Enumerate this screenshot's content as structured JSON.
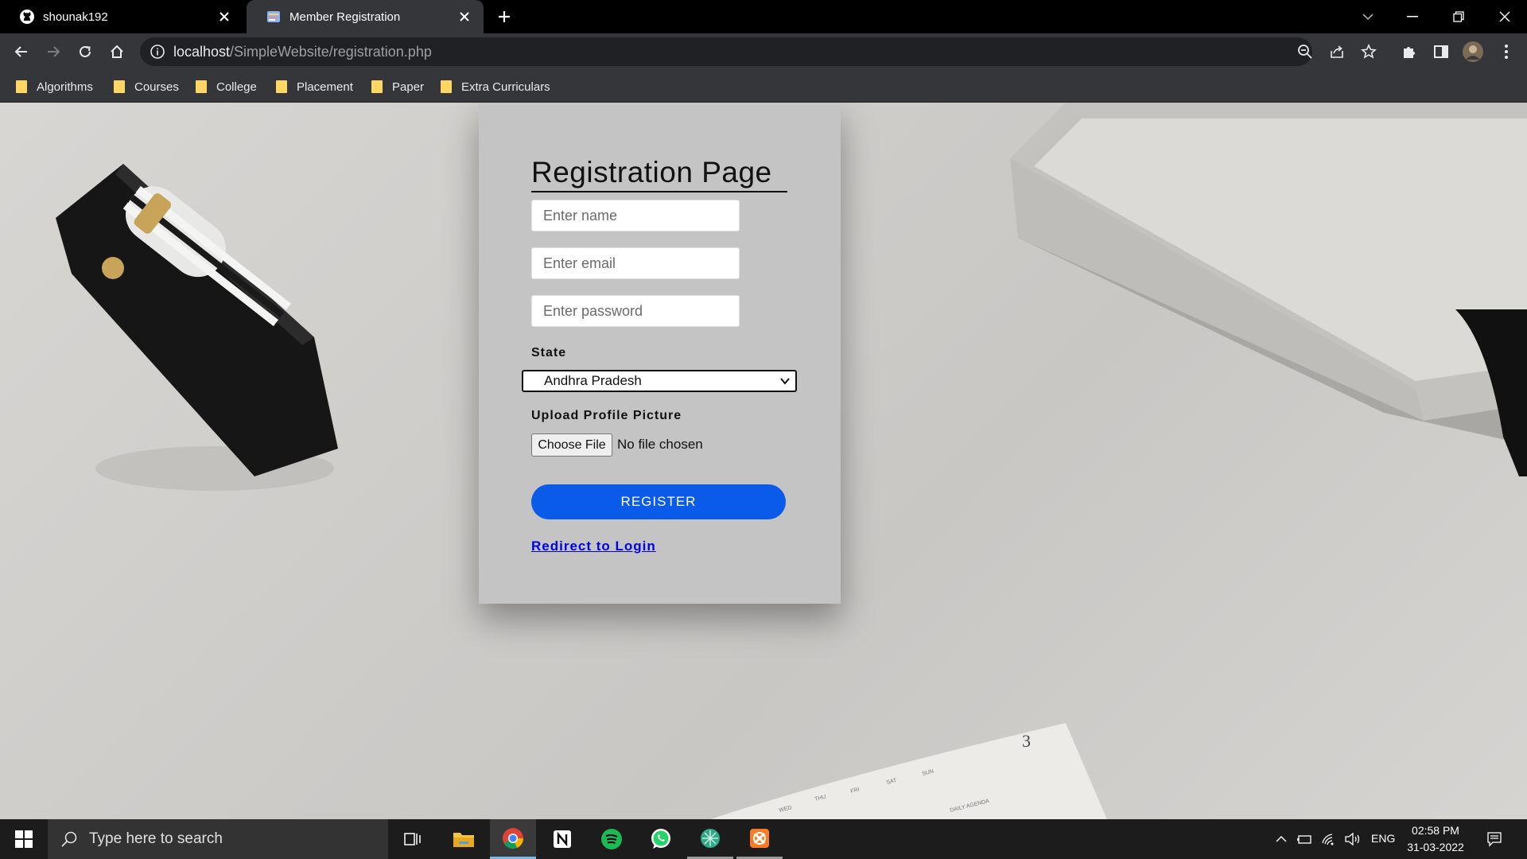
{
  "browser": {
    "tabs": [
      {
        "title": "shounak192",
        "favicon": "github-icon",
        "active": false
      },
      {
        "title": "Member Registration",
        "favicon": "page-icon",
        "active": true
      }
    ],
    "url": {
      "host": "localhost",
      "path": "/SimpleWebsite/registration.php"
    },
    "bookmarks": [
      "Algorithms",
      "Courses",
      "College",
      "Placement",
      "Paper",
      "Extra Curriculars"
    ]
  },
  "form": {
    "title": "Registration Page",
    "name_placeholder": "Enter name",
    "email_placeholder": "Enter email",
    "password_placeholder": "Enter password",
    "state_label": "State",
    "state_value": "Andhra Pradesh",
    "upload_label": "Upload Profile Picture",
    "choose_file_label": "Choose File",
    "file_status": "No file chosen",
    "register_label": "REGISTER",
    "login_link": "Redirect to Login",
    "accent_color": "#0a5bea"
  },
  "background": {
    "agenda_number": "3",
    "agenda_days": [
      "WED",
      "THU",
      "FRI",
      "SAT",
      "SUN"
    ],
    "agenda_caption": "DAILY AGENDA"
  },
  "taskbar": {
    "search_placeholder": "Type here to search",
    "apps": [
      "task-view-icon",
      "file-explorer-icon",
      "chrome-icon",
      "notion-icon",
      "spotify-icon",
      "whatsapp-icon",
      "app-icon",
      "xampp-icon"
    ],
    "language": "ENG",
    "time": "02:58 PM",
    "date": "31-03-2022"
  }
}
